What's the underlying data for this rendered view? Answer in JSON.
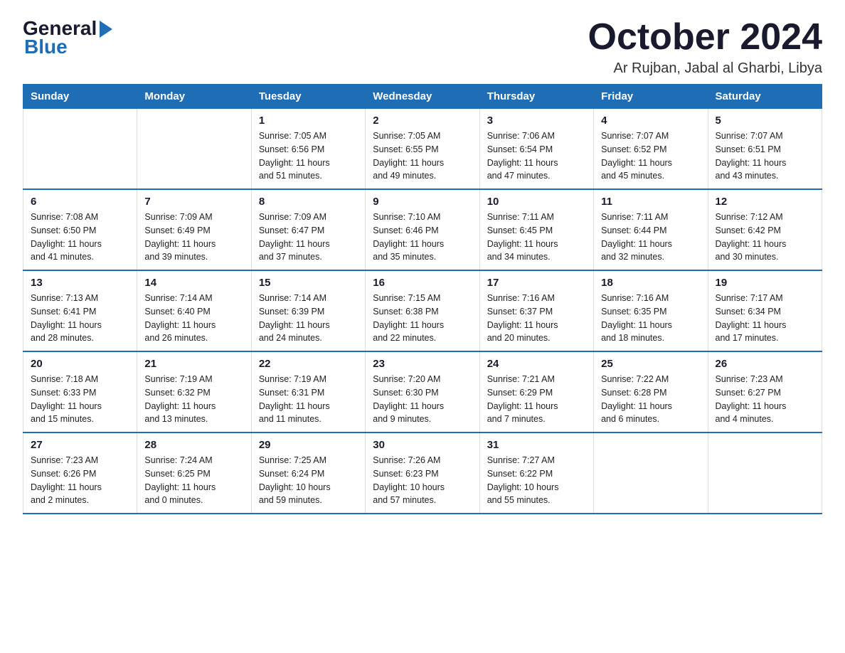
{
  "logo": {
    "general": "General",
    "blue": "Blue"
  },
  "title": "October 2024",
  "location": "Ar Rujban, Jabal al Gharbi, Libya",
  "days_of_week": [
    "Sunday",
    "Monday",
    "Tuesday",
    "Wednesday",
    "Thursday",
    "Friday",
    "Saturday"
  ],
  "weeks": [
    [
      {
        "day": "",
        "info": ""
      },
      {
        "day": "",
        "info": ""
      },
      {
        "day": "1",
        "info": "Sunrise: 7:05 AM\nSunset: 6:56 PM\nDaylight: 11 hours\nand 51 minutes."
      },
      {
        "day": "2",
        "info": "Sunrise: 7:05 AM\nSunset: 6:55 PM\nDaylight: 11 hours\nand 49 minutes."
      },
      {
        "day": "3",
        "info": "Sunrise: 7:06 AM\nSunset: 6:54 PM\nDaylight: 11 hours\nand 47 minutes."
      },
      {
        "day": "4",
        "info": "Sunrise: 7:07 AM\nSunset: 6:52 PM\nDaylight: 11 hours\nand 45 minutes."
      },
      {
        "day": "5",
        "info": "Sunrise: 7:07 AM\nSunset: 6:51 PM\nDaylight: 11 hours\nand 43 minutes."
      }
    ],
    [
      {
        "day": "6",
        "info": "Sunrise: 7:08 AM\nSunset: 6:50 PM\nDaylight: 11 hours\nand 41 minutes."
      },
      {
        "day": "7",
        "info": "Sunrise: 7:09 AM\nSunset: 6:49 PM\nDaylight: 11 hours\nand 39 minutes."
      },
      {
        "day": "8",
        "info": "Sunrise: 7:09 AM\nSunset: 6:47 PM\nDaylight: 11 hours\nand 37 minutes."
      },
      {
        "day": "9",
        "info": "Sunrise: 7:10 AM\nSunset: 6:46 PM\nDaylight: 11 hours\nand 35 minutes."
      },
      {
        "day": "10",
        "info": "Sunrise: 7:11 AM\nSunset: 6:45 PM\nDaylight: 11 hours\nand 34 minutes."
      },
      {
        "day": "11",
        "info": "Sunrise: 7:11 AM\nSunset: 6:44 PM\nDaylight: 11 hours\nand 32 minutes."
      },
      {
        "day": "12",
        "info": "Sunrise: 7:12 AM\nSunset: 6:42 PM\nDaylight: 11 hours\nand 30 minutes."
      }
    ],
    [
      {
        "day": "13",
        "info": "Sunrise: 7:13 AM\nSunset: 6:41 PM\nDaylight: 11 hours\nand 28 minutes."
      },
      {
        "day": "14",
        "info": "Sunrise: 7:14 AM\nSunset: 6:40 PM\nDaylight: 11 hours\nand 26 minutes."
      },
      {
        "day": "15",
        "info": "Sunrise: 7:14 AM\nSunset: 6:39 PM\nDaylight: 11 hours\nand 24 minutes."
      },
      {
        "day": "16",
        "info": "Sunrise: 7:15 AM\nSunset: 6:38 PM\nDaylight: 11 hours\nand 22 minutes."
      },
      {
        "day": "17",
        "info": "Sunrise: 7:16 AM\nSunset: 6:37 PM\nDaylight: 11 hours\nand 20 minutes."
      },
      {
        "day": "18",
        "info": "Sunrise: 7:16 AM\nSunset: 6:35 PM\nDaylight: 11 hours\nand 18 minutes."
      },
      {
        "day": "19",
        "info": "Sunrise: 7:17 AM\nSunset: 6:34 PM\nDaylight: 11 hours\nand 17 minutes."
      }
    ],
    [
      {
        "day": "20",
        "info": "Sunrise: 7:18 AM\nSunset: 6:33 PM\nDaylight: 11 hours\nand 15 minutes."
      },
      {
        "day": "21",
        "info": "Sunrise: 7:19 AM\nSunset: 6:32 PM\nDaylight: 11 hours\nand 13 minutes."
      },
      {
        "day": "22",
        "info": "Sunrise: 7:19 AM\nSunset: 6:31 PM\nDaylight: 11 hours\nand 11 minutes."
      },
      {
        "day": "23",
        "info": "Sunrise: 7:20 AM\nSunset: 6:30 PM\nDaylight: 11 hours\nand 9 minutes."
      },
      {
        "day": "24",
        "info": "Sunrise: 7:21 AM\nSunset: 6:29 PM\nDaylight: 11 hours\nand 7 minutes."
      },
      {
        "day": "25",
        "info": "Sunrise: 7:22 AM\nSunset: 6:28 PM\nDaylight: 11 hours\nand 6 minutes."
      },
      {
        "day": "26",
        "info": "Sunrise: 7:23 AM\nSunset: 6:27 PM\nDaylight: 11 hours\nand 4 minutes."
      }
    ],
    [
      {
        "day": "27",
        "info": "Sunrise: 7:23 AM\nSunset: 6:26 PM\nDaylight: 11 hours\nand 2 minutes."
      },
      {
        "day": "28",
        "info": "Sunrise: 7:24 AM\nSunset: 6:25 PM\nDaylight: 11 hours\nand 0 minutes."
      },
      {
        "day": "29",
        "info": "Sunrise: 7:25 AM\nSunset: 6:24 PM\nDaylight: 10 hours\nand 59 minutes."
      },
      {
        "day": "30",
        "info": "Sunrise: 7:26 AM\nSunset: 6:23 PM\nDaylight: 10 hours\nand 57 minutes."
      },
      {
        "day": "31",
        "info": "Sunrise: 7:27 AM\nSunset: 6:22 PM\nDaylight: 10 hours\nand 55 minutes."
      },
      {
        "day": "",
        "info": ""
      },
      {
        "day": "",
        "info": ""
      }
    ]
  ]
}
